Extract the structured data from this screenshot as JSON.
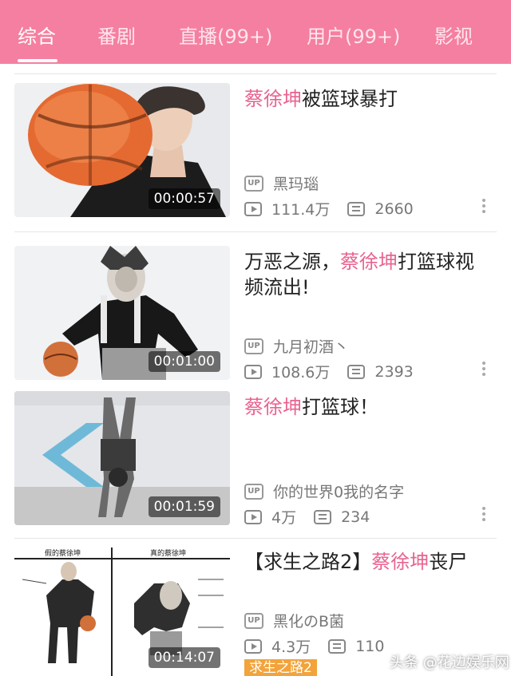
{
  "tabs": [
    {
      "label": "综合"
    },
    {
      "label": "番剧"
    },
    {
      "label": "直播(99+)"
    },
    {
      "label": "用户(99+)"
    },
    {
      "label": "影视"
    }
  ],
  "videos": [
    {
      "title_prefix": "",
      "title_highlight": "蔡徐坤",
      "title_suffix": "被篮球暴打",
      "duration": "00:00:57",
      "uploader": "黑玛瑙",
      "views": "111.4万",
      "comments": "2660"
    },
    {
      "title_prefix": "万恶之源，",
      "title_highlight": "蔡徐坤",
      "title_suffix": "打篮球视频流出!",
      "duration": "00:01:00",
      "uploader": "九月初酒丶",
      "views": "108.6万",
      "comments": "2393"
    },
    {
      "title_prefix": "",
      "title_highlight": "蔡徐坤",
      "title_suffix": "打篮球！",
      "duration": "00:01:59",
      "uploader": "你的世界0我的名字",
      "views": "4万",
      "comments": "234"
    },
    {
      "title_prefix": "【求生之路2】",
      "title_highlight": "蔡徐坤",
      "title_suffix": "丧尸",
      "duration": "00:14:07",
      "uploader": "黑化のB菌",
      "views": "4.3万",
      "comments": "110",
      "tag": "求生之路2",
      "thumb_labels": {
        "left": "假的蔡徐坤",
        "right": "真的蔡徐坤"
      }
    }
  ],
  "badge": {
    "up": "UP"
  },
  "watermark": "头条 @花边娱乐网",
  "colors": {
    "accent": "#f57fa0",
    "highlight": "#e8648f",
    "tag": "#f2a33a"
  }
}
